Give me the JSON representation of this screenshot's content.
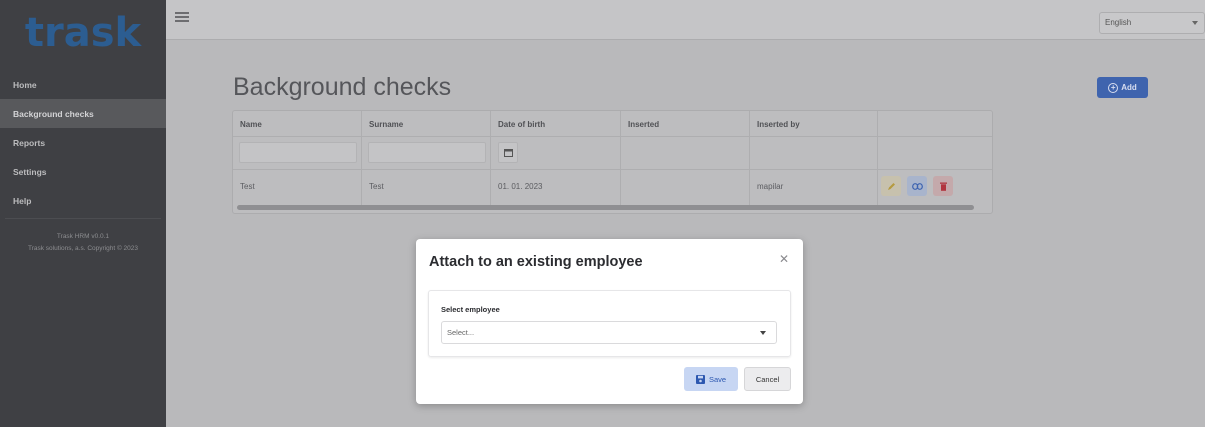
{
  "sidebar": {
    "logo": "trask",
    "items": [
      {
        "label": "Home"
      },
      {
        "label": "Background checks"
      },
      {
        "label": "Reports"
      },
      {
        "label": "Settings"
      },
      {
        "label": "Help"
      }
    ],
    "footer_version": "Trask HRM v0.0.1",
    "footer_copyright": "Trask solutions, a.s. Copyright © 2023"
  },
  "topbar": {
    "language": "English"
  },
  "main": {
    "title": "Background checks",
    "add_label": "Add",
    "table": {
      "columns": [
        "Name",
        "Surname",
        "Date of birth",
        "Inserted",
        "Inserted by"
      ],
      "rows": [
        {
          "name": "Test",
          "surname": "Test",
          "dob": "01. 01. 2023",
          "inserted": "",
          "inserted_by": "mapilar"
        }
      ]
    }
  },
  "modal": {
    "title": "Attach to an existing employee",
    "field_label": "Select employee",
    "select_placeholder": "Select...",
    "save_label": "Save",
    "cancel_label": "Cancel"
  },
  "colors": {
    "sidebar_bg": "#3f4044",
    "logo": "#2c5d91",
    "primary": "#3f64ae",
    "overlay": "#b9b9bb"
  }
}
